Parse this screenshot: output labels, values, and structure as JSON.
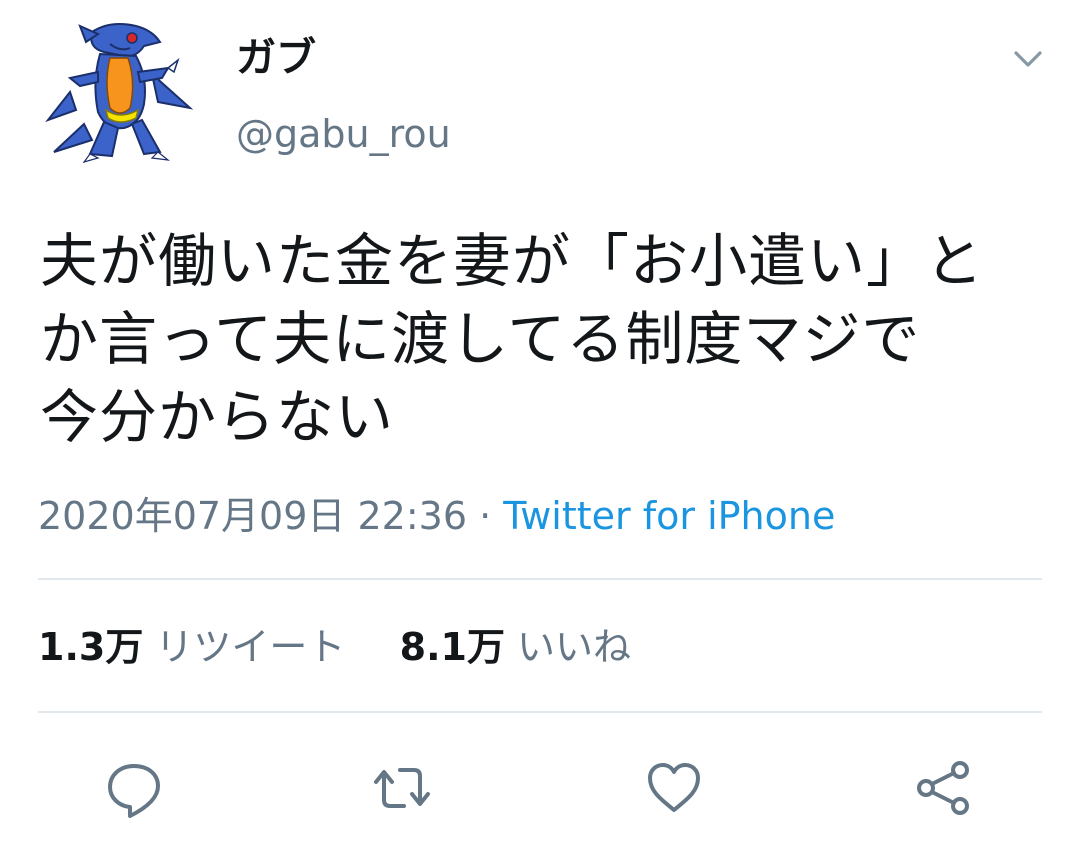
{
  "user": {
    "display_name": "ガブ",
    "handle": "@gabu_rou",
    "avatar_icon": "garchomp-avatar"
  },
  "tweet": {
    "text_lines": [
      "夫が働いた金を妻が「お小遣い」と",
      "か言って夫に渡してる制度マジで",
      "今分からない"
    ],
    "timestamp": "2020年07月09日 22:36",
    "separator": "·",
    "source": "Twitter for iPhone"
  },
  "stats": {
    "retweets_count": "1.3万",
    "retweets_label": "リツイート",
    "likes_count": "8.1万",
    "likes_label": "いいね"
  },
  "actions": {
    "reply_icon": "reply-icon",
    "retweet_icon": "retweet-icon",
    "like_icon": "heart-icon",
    "share_icon": "share-icon"
  },
  "colors": {
    "text": "#14171a",
    "secondary": "#657786",
    "link": "#1b95e0",
    "divider": "#e1e8ed"
  }
}
